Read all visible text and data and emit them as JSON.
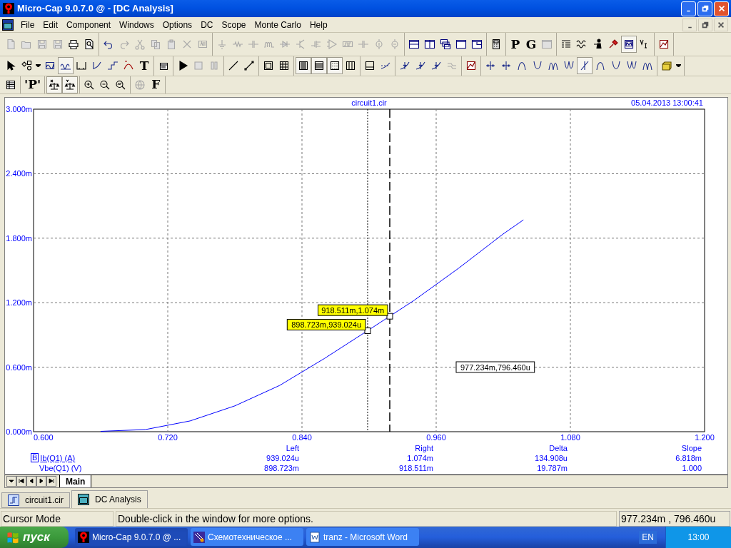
{
  "window": {
    "title": "Micro-Cap 9.0.7.0 @ - [DC Analysis]"
  },
  "menu": [
    "File",
    "Edit",
    "Component",
    "Windows",
    "Options",
    "DC",
    "Scope",
    "Monte Carlo",
    "Help"
  ],
  "toolbars": [
    [
      [
        {
          "kind": "icon",
          "disabled": true,
          "pressed": false
        },
        {
          "kind": "icon",
          "disabled": true,
          "pressed": false
        },
        {
          "kind": "icon",
          "disabled": true,
          "pressed": false
        },
        {
          "kind": "icon",
          "disabled": true,
          "pressed": false
        },
        {
          "kind": "icon",
          "disabled": false,
          "pressed": false
        },
        {
          "kind": "icon",
          "disabled": false,
          "pressed": false
        }
      ],
      [
        {
          "kind": "icon",
          "disabled": false,
          "pressed": false
        },
        {
          "kind": "icon",
          "disabled": true,
          "pressed": false
        },
        {
          "kind": "icon",
          "disabled": true,
          "pressed": false
        },
        {
          "kind": "icon",
          "disabled": true,
          "pressed": false
        },
        {
          "kind": "icon",
          "disabled": true,
          "pressed": false
        },
        {
          "kind": "icon",
          "disabled": true,
          "pressed": false
        },
        {
          "kind": "icon",
          "disabled": true,
          "pressed": false
        }
      ],
      [
        {
          "kind": "icon",
          "disabled": true,
          "pressed": false
        },
        {
          "kind": "icon",
          "disabled": true,
          "pressed": false
        },
        {
          "kind": "icon",
          "disabled": true,
          "pressed": false
        },
        {
          "kind": "icon",
          "disabled": true,
          "pressed": false
        },
        {
          "kind": "icon",
          "disabled": true,
          "pressed": false
        },
        {
          "kind": "icon",
          "disabled": true,
          "pressed": false
        },
        {
          "kind": "icon",
          "disabled": true,
          "pressed": false
        },
        {
          "kind": "icon",
          "disabled": true,
          "pressed": false
        },
        {
          "kind": "icon",
          "disabled": true,
          "pressed": false
        },
        {
          "kind": "icon",
          "disabled": true,
          "pressed": false
        },
        {
          "kind": "icon",
          "disabled": true,
          "pressed": false
        },
        {
          "kind": "icon",
          "disabled": true,
          "pressed": false
        }
      ],
      [
        {
          "kind": "icon",
          "disabled": false,
          "pressed": false
        },
        {
          "kind": "icon",
          "disabled": false,
          "pressed": false
        },
        {
          "kind": "icon",
          "disabled": false,
          "pressed": false
        },
        {
          "kind": "icon",
          "disabled": false,
          "pressed": false
        },
        {
          "kind": "icon",
          "disabled": false,
          "pressed": false
        }
      ],
      [
        {
          "kind": "icon",
          "disabled": false,
          "pressed": false
        }
      ],
      [
        {
          "kind": "glyph",
          "text": "P",
          "disabled": false,
          "pressed": false
        },
        {
          "kind": "glyph",
          "text": "G",
          "disabled": false,
          "pressed": false
        },
        {
          "kind": "icon",
          "disabled": true,
          "pressed": false
        }
      ],
      [
        {
          "kind": "icon",
          "disabled": false,
          "pressed": false
        },
        {
          "kind": "icon",
          "disabled": false,
          "pressed": false
        },
        {
          "kind": "icon",
          "disabled": false,
          "pressed": false
        },
        {
          "kind": "icon",
          "disabled": false,
          "pressed": false
        },
        {
          "kind": "icon",
          "disabled": false,
          "pressed": true
        },
        {
          "kind": "icon",
          "disabled": false,
          "pressed": false
        }
      ],
      [
        {
          "kind": "icon",
          "disabled": false,
          "pressed": false
        }
      ]
    ],
    [
      [
        {
          "kind": "icon",
          "disabled": false,
          "pressed": false
        },
        {
          "kind": "icon",
          "disabled": false,
          "pressed": false
        },
        {
          "kind": "icon",
          "disabled": false,
          "pressed": false
        },
        {
          "kind": "icon",
          "disabled": false,
          "pressed": false
        },
        {
          "kind": "icon",
          "disabled": false,
          "pressed": true
        },
        {
          "kind": "icon",
          "disabled": false,
          "pressed": false
        },
        {
          "kind": "icon",
          "disabled": false,
          "pressed": false
        },
        {
          "kind": "icon",
          "disabled": false,
          "pressed": false
        },
        {
          "kind": "icon",
          "disabled": false,
          "pressed": false
        },
        {
          "kind": "glyph",
          "text": "T",
          "disabled": false,
          "pressed": false
        }
      ],
      [
        {
          "kind": "icon",
          "disabled": false,
          "pressed": false
        }
      ],
      [
        {
          "kind": "icon",
          "disabled": false,
          "pressed": false
        },
        {
          "kind": "icon",
          "disabled": true,
          "pressed": false
        },
        {
          "kind": "icon",
          "disabled": true,
          "pressed": false
        }
      ],
      [
        {
          "kind": "icon",
          "disabled": false,
          "pressed": false
        },
        {
          "kind": "icon",
          "disabled": false,
          "pressed": false
        }
      ],
      [
        {
          "kind": "icon",
          "disabled": false,
          "pressed": false
        },
        {
          "kind": "icon",
          "disabled": false,
          "pressed": false
        }
      ],
      [
        {
          "kind": "icon",
          "disabled": false,
          "pressed": true
        },
        {
          "kind": "icon",
          "disabled": false,
          "pressed": true
        },
        {
          "kind": "icon",
          "disabled": false,
          "pressed": true
        },
        {
          "kind": "icon",
          "disabled": false,
          "pressed": false
        }
      ],
      [
        {
          "kind": "icon",
          "disabled": false,
          "pressed": false
        },
        {
          "kind": "icon",
          "disabled": false,
          "pressed": false
        }
      ],
      [
        {
          "kind": "icon",
          "disabled": false,
          "pressed": false
        },
        {
          "kind": "icon",
          "disabled": false,
          "pressed": false
        },
        {
          "kind": "icon",
          "disabled": false,
          "pressed": false
        },
        {
          "kind": "icon",
          "disabled": true,
          "pressed": false
        }
      ],
      [
        {
          "kind": "icon",
          "disabled": false,
          "pressed": false
        }
      ],
      [
        {
          "kind": "icon",
          "disabled": false,
          "pressed": false
        },
        {
          "kind": "icon",
          "disabled": false,
          "pressed": false
        },
        {
          "kind": "icon",
          "disabled": false,
          "pressed": false
        },
        {
          "kind": "icon",
          "disabled": false,
          "pressed": false
        },
        {
          "kind": "icon",
          "disabled": false,
          "pressed": false
        },
        {
          "kind": "icon",
          "disabled": false,
          "pressed": false
        },
        {
          "kind": "icon",
          "disabled": false,
          "pressed": true
        },
        {
          "kind": "icon",
          "disabled": false,
          "pressed": false
        },
        {
          "kind": "icon",
          "disabled": false,
          "pressed": false
        },
        {
          "kind": "icon",
          "disabled": false,
          "pressed": false
        },
        {
          "kind": "icon",
          "disabled": false,
          "pressed": false
        }
      ],
      [
        {
          "kind": "icon",
          "disabled": false,
          "pressed": false
        },
        {
          "kind": "icon",
          "disabled": false,
          "pressed": false
        }
      ]
    ],
    [
      [
        {
          "kind": "icon",
          "disabled": false,
          "pressed": false
        }
      ],
      [
        {
          "kind": "glyph",
          "text": "'P'",
          "disabled": false,
          "pressed": false
        }
      ],
      [
        {
          "kind": "icon",
          "disabled": false,
          "pressed": true
        },
        {
          "kind": "icon",
          "disabled": false,
          "pressed": true
        }
      ],
      [
        {
          "kind": "icon",
          "disabled": false,
          "pressed": false
        },
        {
          "kind": "icon",
          "disabled": false,
          "pressed": false
        },
        {
          "kind": "icon",
          "disabled": false,
          "pressed": false
        }
      ],
      [
        {
          "kind": "icon",
          "disabled": true,
          "pressed": false
        },
        {
          "kind": "glyph",
          "text": "F",
          "disabled": false,
          "pressed": false
        }
      ]
    ]
  ],
  "plot": {
    "timestamp": "05.04.2013 13:00:41",
    "chart_data": {
      "type": "line",
      "title": "circuit1.cir",
      "xlim": [
        0.6,
        1.2
      ],
      "ylim": [
        0,
        3
      ],
      "xticks": [
        {
          "value": 0.6,
          "label": "0.600"
        },
        {
          "value": 0.72,
          "label": "0.720"
        },
        {
          "value": 0.84,
          "label": "0.840"
        },
        {
          "value": 0.96,
          "label": "0.960"
        },
        {
          "value": 1.08,
          "label": "1.080"
        },
        {
          "value": 1.2,
          "label": "1.200"
        }
      ],
      "yticks": [
        {
          "value": 0,
          "label": "0.000m"
        },
        {
          "value": 0.6,
          "label": "0.600m"
        },
        {
          "value": 1.2,
          "label": "1.200m"
        },
        {
          "value": 1.8,
          "label": "1.800m"
        },
        {
          "value": 2.4,
          "label": "2.400m"
        },
        {
          "value": 3,
          "label": "3.000m"
        }
      ],
      "grid": true,
      "x": [
        0.66,
        0.7,
        0.74,
        0.78,
        0.82,
        0.86,
        0.898723,
        0.918511,
        0.94,
        0.98,
        1.02,
        1.038
      ],
      "series": [
        {
          "name": "Ib(Q1) (A)",
          "color": "#0000ff",
          "values": [
            0.003,
            0.02,
            0.1,
            0.24,
            0.43,
            0.68,
            0.94,
            1.074,
            1.22,
            1.52,
            1.84,
            1.97
          ]
        }
      ],
      "ref_lines": [
        {
          "axis": "x",
          "value": 0.898723
        },
        {
          "axis": "x",
          "value": 0.918511
        }
      ],
      "annotations": [
        {
          "x": 0.898723,
          "y": 0.939024,
          "text": "898.723m,939.024u"
        },
        {
          "x": 0.918511,
          "y": 1.074,
          "text": "918.511m,1.074m"
        },
        {
          "text": "977.234m,796.460u"
        }
      ]
    }
  },
  "cursor_table": {
    "headers": [
      "Left",
      "Right",
      "Delta",
      "Slope"
    ],
    "rows": [
      {
        "badge": "B",
        "selected": true,
        "values": [
          "939.024u",
          "1.074m",
          "134.908u",
          "6.818m"
        ]
      },
      {
        "name": "Vbe(Q1) (V)",
        "selected": false,
        "values": [
          "898.723m",
          "918.511m",
          "19.787m",
          "1.000"
        ]
      }
    ]
  },
  "page_tabs": [
    {
      "label": "Main",
      "selected": true
    }
  ],
  "document_tabs": [
    {
      "label": "circuit1.cir",
      "selected": false
    },
    {
      "label": "DC Analysis",
      "selected": true
    }
  ],
  "status_bar": {
    "mode": "Cursor Mode",
    "message": "Double-click in the window for more options.",
    "position": "977.234m , 796.460u"
  },
  "taskbar": {
    "start": "пуск",
    "items": [
      {
        "label": "Micro-Cap 9.0.7.0 @ ...",
        "selected": true
      },
      {
        "label": "Схемотехническое ...",
        "selected": false
      },
      {
        "label": "tranz - Microsoft Word",
        "selected": false
      }
    ],
    "language": "EN",
    "clock": "13:00"
  }
}
